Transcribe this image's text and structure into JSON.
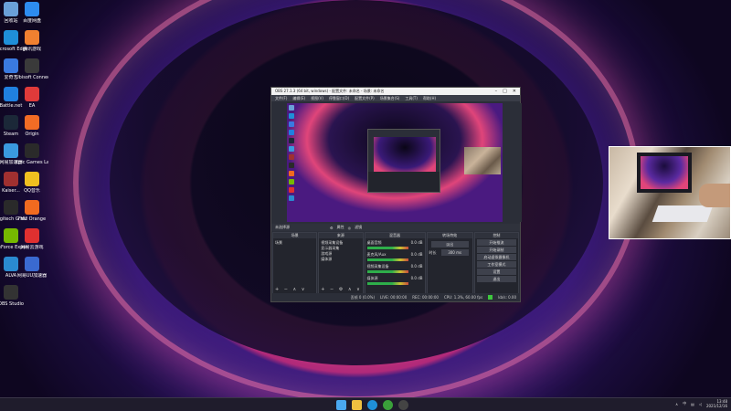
{
  "desktop": {
    "icons": [
      {
        "label": "回收站",
        "icon": "recycle-bin-icon",
        "color": "#6aa0d8"
      },
      {
        "label": "百度网盘",
        "icon": "baidu-netdisk-icon",
        "color": "#2d8cf0"
      },
      {
        "label": "Microsoft Edge",
        "icon": "edge-icon",
        "color": "#1f8fd8"
      },
      {
        "label": "腾讯游戏",
        "icon": "tencent-games-icon",
        "color": "#f08030"
      },
      {
        "label": "爱奇艺",
        "icon": "video-player-icon",
        "color": "#3a7ae0"
      },
      {
        "label": "Ubisoft Connect",
        "icon": "ubisoft-icon",
        "color": "#3a3a3a"
      },
      {
        "label": "Battle.net",
        "icon": "battlenet-icon",
        "color": "#2080e0"
      },
      {
        "label": "EA",
        "icon": "ea-icon",
        "color": "#e03a3a"
      },
      {
        "label": "Steam",
        "icon": "steam-icon",
        "color": "#1b2838"
      },
      {
        "label": "Origin",
        "icon": "origin-icon",
        "color": "#f26c25"
      },
      {
        "label": "网易加速器",
        "icon": "accelerator-icon",
        "color": "#3a9ae0"
      },
      {
        "label": "Epic Games Launcher",
        "icon": "epic-icon",
        "color": "#2a2a2a"
      },
      {
        "label": "Kaiser...",
        "icon": "kaiser-icon",
        "color": "#a03030"
      },
      {
        "label": "QQ音乐",
        "icon": "qq-music-icon",
        "color": "#f0c020"
      },
      {
        "label": "Logitech G HUB",
        "icon": "logitech-icon",
        "color": "#2a2a2a"
      },
      {
        "label": "Fast Orange",
        "icon": "fast-orange-icon",
        "color": "#f06a20"
      },
      {
        "label": "GeForce Experience",
        "icon": "geforce-icon",
        "color": "#76b900"
      },
      {
        "label": "网易云游戏",
        "icon": "cloud-game-icon",
        "color": "#e03030"
      },
      {
        "label": "ALVA",
        "icon": "alva-icon",
        "color": "#2a8ad0"
      },
      {
        "label": "网易UU加速器",
        "icon": "uu-accelerator-icon",
        "color": "#3a6ad0"
      },
      {
        "label": "OBS Studio",
        "icon": "obs-icon",
        "color": "#333333"
      }
    ]
  },
  "obs": {
    "title": "OBS 27.1.3 (64 bit, windows) - 配置文件: 未命名 - 场景: 未命名",
    "menu": [
      "文件(F)",
      "编辑(E)",
      "视图(V)",
      "停靠窗口(D)",
      "配置文件(P)",
      "场景集合(S)",
      "工具(T)",
      "帮助(H)"
    ],
    "toolbar_label": "未选择源",
    "toolbar_props": "属性",
    "toolbar_filters": "滤镜",
    "docks": {
      "scenes": {
        "title": "场景",
        "items": [
          "场景"
        ]
      },
      "sources": {
        "title": "来源",
        "items": [
          "视频采集设备",
          "显示器采集",
          "游戏源",
          "媒体源"
        ]
      },
      "mixer": {
        "title": "混音器",
        "channels": [
          {
            "name": "桌面音频",
            "db": "0.0 dB"
          },
          {
            "name": "麦克风/Aux",
            "db": "0.0 dB"
          },
          {
            "name": "视频采集设备",
            "db": "0.0 dB"
          },
          {
            "name": "媒体源",
            "db": "0.0 dB"
          }
        ]
      },
      "transitions": {
        "title": "转场特效",
        "type": "淡出",
        "duration_label": "时长",
        "duration": "300 ms"
      },
      "controls": {
        "title": "控制",
        "buttons": [
          "开始推流",
          "开始录制",
          "启动虚拟摄像机",
          "工作室模式",
          "设置",
          "退出"
        ]
      }
    },
    "status": {
      "dropped": "丢帧 0 (0.0%)",
      "live": "LIVE: 00:00:00",
      "rec": "REC: 00:00:00",
      "cpu": "CPU: 1.3%, 60.00 fps",
      "kbps": "kb/s: 0.00"
    },
    "colors": {
      "status_indicator": "#3ec83e"
    }
  },
  "taskbar": {
    "icons": [
      "windows-start-icon",
      "file-explorer-icon",
      "edge-icon",
      "xbox-icon",
      "obs-icon"
    ],
    "time": "13:48",
    "date": "2021/12/16",
    "language": "中"
  }
}
